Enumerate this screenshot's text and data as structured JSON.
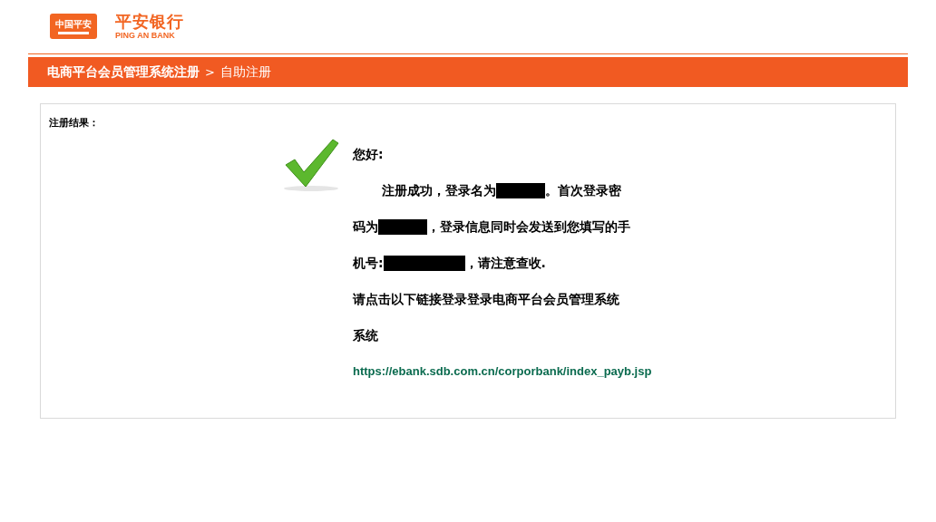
{
  "logo": {
    "badge": "中国平安",
    "name": "平安银行",
    "name_en": "PING AN BANK"
  },
  "breadcrumb": {
    "title": "电商平台会员管理系统注册",
    "separator": ">",
    "current": "自助注册"
  },
  "panel": {
    "label": "注册结果：",
    "greeting": "您好:",
    "lines": [
      {
        "parts": [
          {
            "kind": "text",
            "text": "注册成功，登录名为"
          },
          {
            "kind": "redaction"
          },
          {
            "kind": "text",
            "text": "。首次登录密"
          }
        ]
      },
      {
        "parts": [
          {
            "kind": "text",
            "text": "码为"
          },
          {
            "kind": "redaction"
          },
          {
            "kind": "text",
            "text": "，登录信息同时会发送到您填写的手"
          }
        ]
      },
      {
        "parts": [
          {
            "kind": "text",
            "text": "机号:"
          },
          {
            "kind": "widered"
          },
          {
            "kind": "text",
            "text": "，请注意查收."
          }
        ]
      },
      {
        "parts": [
          {
            "kind": "text",
            "text": "请点击以下链接登录登录电商平台会员管理系统"
          }
        ]
      },
      {
        "parts": [
          {
            "kind": "text",
            "text": "系统"
          }
        ]
      }
    ],
    "link": "https://ebank.sdb.com.cn/corporbank/index_payb.jsp"
  }
}
